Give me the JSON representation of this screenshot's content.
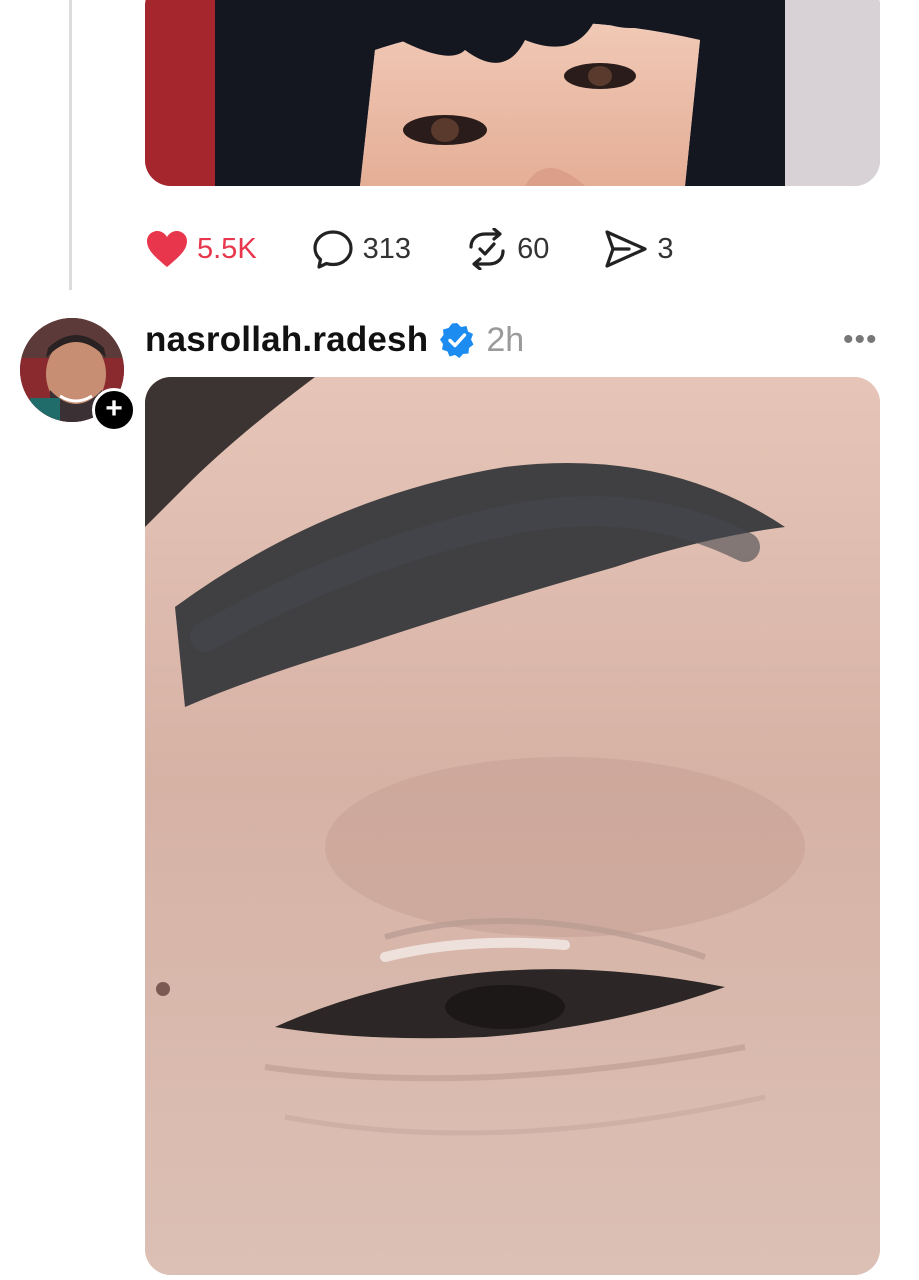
{
  "previous_post": {
    "actions": {
      "likes": "5.5K",
      "comments": "313",
      "reposts": "60",
      "shares": "3"
    }
  },
  "post": {
    "username": "nasrollah.radesh",
    "time": "2h",
    "verified": true,
    "follow_symbol": "+",
    "more_symbol": "•••"
  },
  "icons": {
    "like": "heart-icon",
    "comment": "comment-bubble-icon",
    "repost": "repost-icon",
    "share": "send-icon",
    "verified": "verified-badge-icon"
  },
  "colors": {
    "like": "#e8364c",
    "verified": "#1d8cf0",
    "muted": "#9a9a9a"
  }
}
